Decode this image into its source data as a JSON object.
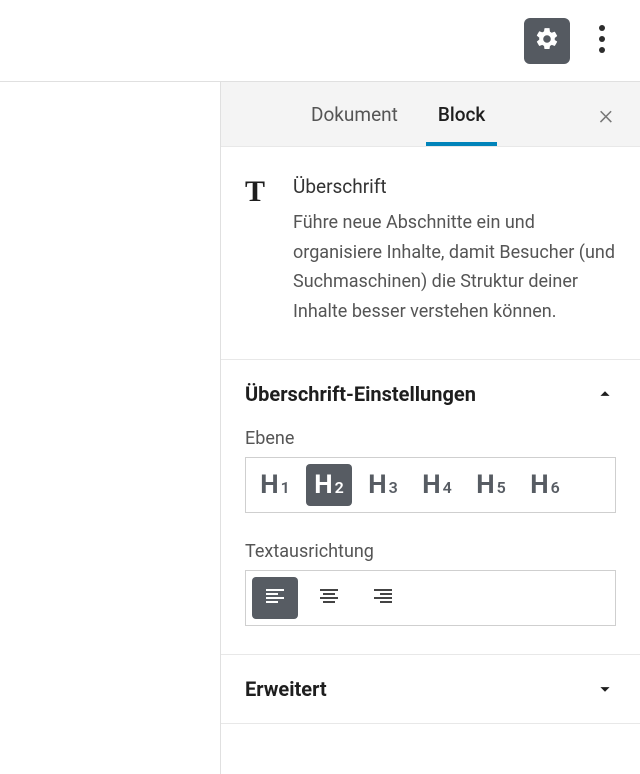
{
  "topbar": {
    "settings_icon": "gear",
    "more_icon": "kebab"
  },
  "tabs": {
    "document": "Dokument",
    "block": "Block",
    "close_label": "×"
  },
  "block": {
    "icon": "T",
    "title": "Überschrift",
    "description": "Führe neue Abschnitte ein und organisiere Inhalte, damit Besucher (und Suchmaschinen) die Struktur deiner Inhalte besser verstehen können."
  },
  "panels": {
    "heading": {
      "title": "Überschrift-Einstellungen",
      "level_label": "Ebene",
      "levels": [
        "H1",
        "H2",
        "H3",
        "H4",
        "H5",
        "H6"
      ],
      "active_level": "H2",
      "align_label": "Textausrichtung",
      "aligns": [
        "left",
        "center",
        "right"
      ],
      "active_align": "left"
    },
    "advanced": {
      "title": "Erweitert"
    }
  }
}
